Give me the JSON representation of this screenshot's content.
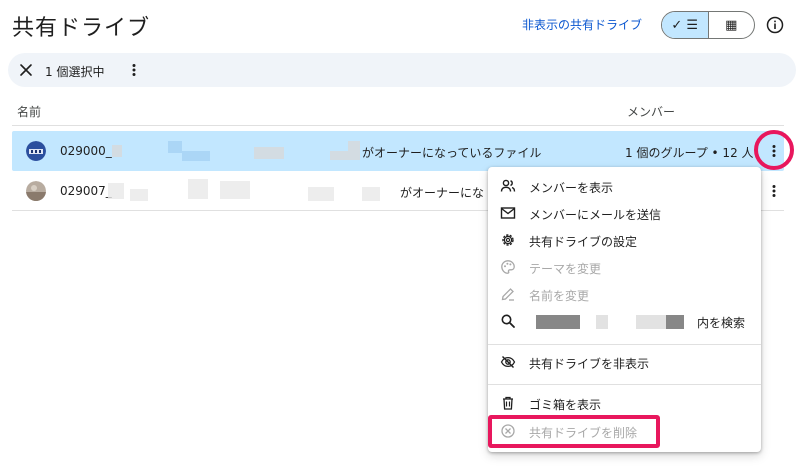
{
  "header": {
    "title": "共有ドライブ",
    "hidden_link": "非表示の共有ドライブ",
    "view_list_label": "✓ ☰",
    "view_grid_label": "▦"
  },
  "selection_bar": {
    "count": "1 個選択中"
  },
  "columns": {
    "name": "名前",
    "members": "メンバー"
  },
  "rows": [
    {
      "name": "029000_",
      "suffix": "がオーナーになっているファイル",
      "members": "1 個のグループ • 12 人"
    },
    {
      "name": "029007_",
      "suffix": "がオーナーにな"
    }
  ],
  "menu": {
    "items": [
      {
        "label": "メンバーを表示",
        "icon": "people-icon"
      },
      {
        "label": "メンバーにメールを送信",
        "icon": "mail-icon"
      },
      {
        "label": "共有ドライブの設定",
        "icon": "gear-icon"
      },
      {
        "label": "テーマを変更",
        "icon": "palette-icon"
      },
      {
        "label": "名前を変更",
        "icon": "pencil-icon"
      },
      {
        "label": "内を検索",
        "icon": "search-icon"
      },
      {
        "label": "共有ドライブを非表示",
        "icon": "eye-off-icon"
      },
      {
        "label": "ゴミ箱を表示",
        "icon": "trash-icon"
      },
      {
        "label": "共有ドライブを削除",
        "icon": "cancel-circle-icon"
      }
    ]
  },
  "colors": {
    "accent": "#0b57d0",
    "selected_row": "#c2e7ff",
    "highlight": "#e8175d"
  }
}
